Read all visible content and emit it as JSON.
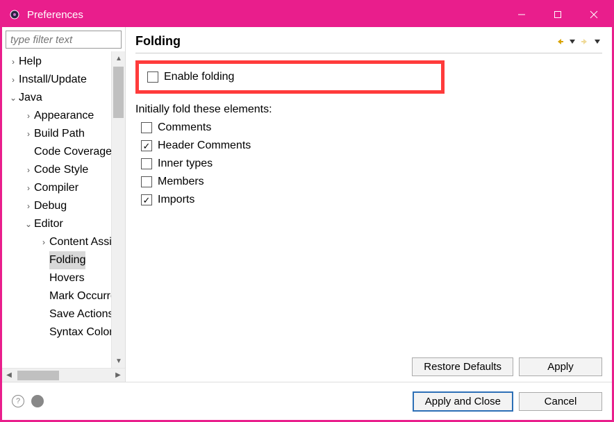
{
  "window": {
    "title": "Preferences"
  },
  "filter": {
    "placeholder": "type filter text"
  },
  "tree": {
    "items": [
      {
        "label": "Help",
        "level": 0,
        "twisty": "collapsed"
      },
      {
        "label": "Install/Update",
        "level": 0,
        "twisty": "collapsed"
      },
      {
        "label": "Java",
        "level": 0,
        "twisty": "expanded"
      },
      {
        "label": "Appearance",
        "level": 1,
        "twisty": "collapsed"
      },
      {
        "label": "Build Path",
        "level": 1,
        "twisty": "collapsed"
      },
      {
        "label": "Code Coverage",
        "level": 1,
        "twisty": "none"
      },
      {
        "label": "Code Style",
        "level": 1,
        "twisty": "collapsed"
      },
      {
        "label": "Compiler",
        "level": 1,
        "twisty": "collapsed"
      },
      {
        "label": "Debug",
        "level": 1,
        "twisty": "collapsed"
      },
      {
        "label": "Editor",
        "level": 1,
        "twisty": "expanded"
      },
      {
        "label": "Content Assist",
        "level": 2,
        "twisty": "collapsed"
      },
      {
        "label": "Folding",
        "level": 2,
        "twisty": "none",
        "selected": true
      },
      {
        "label": "Hovers",
        "level": 2,
        "twisty": "none"
      },
      {
        "label": "Mark Occurrences",
        "level": 2,
        "twisty": "none"
      },
      {
        "label": "Save Actions",
        "level": 2,
        "twisty": "none"
      },
      {
        "label": "Syntax Coloring",
        "level": 2,
        "twisty": "none"
      }
    ]
  },
  "panel": {
    "title": "Folding",
    "enable_label": "Enable folding",
    "enable_checked": false,
    "section_label": "Initially fold these elements:",
    "options": [
      {
        "label": "Comments",
        "checked": false
      },
      {
        "label": "Header Comments",
        "checked": true
      },
      {
        "label": "Inner types",
        "checked": false
      },
      {
        "label": "Members",
        "checked": false
      },
      {
        "label": "Imports",
        "checked": true
      }
    ],
    "buttons": {
      "restore": "Restore Defaults",
      "apply": "Apply"
    }
  },
  "bottom": {
    "apply_close": "Apply and Close",
    "cancel": "Cancel"
  }
}
